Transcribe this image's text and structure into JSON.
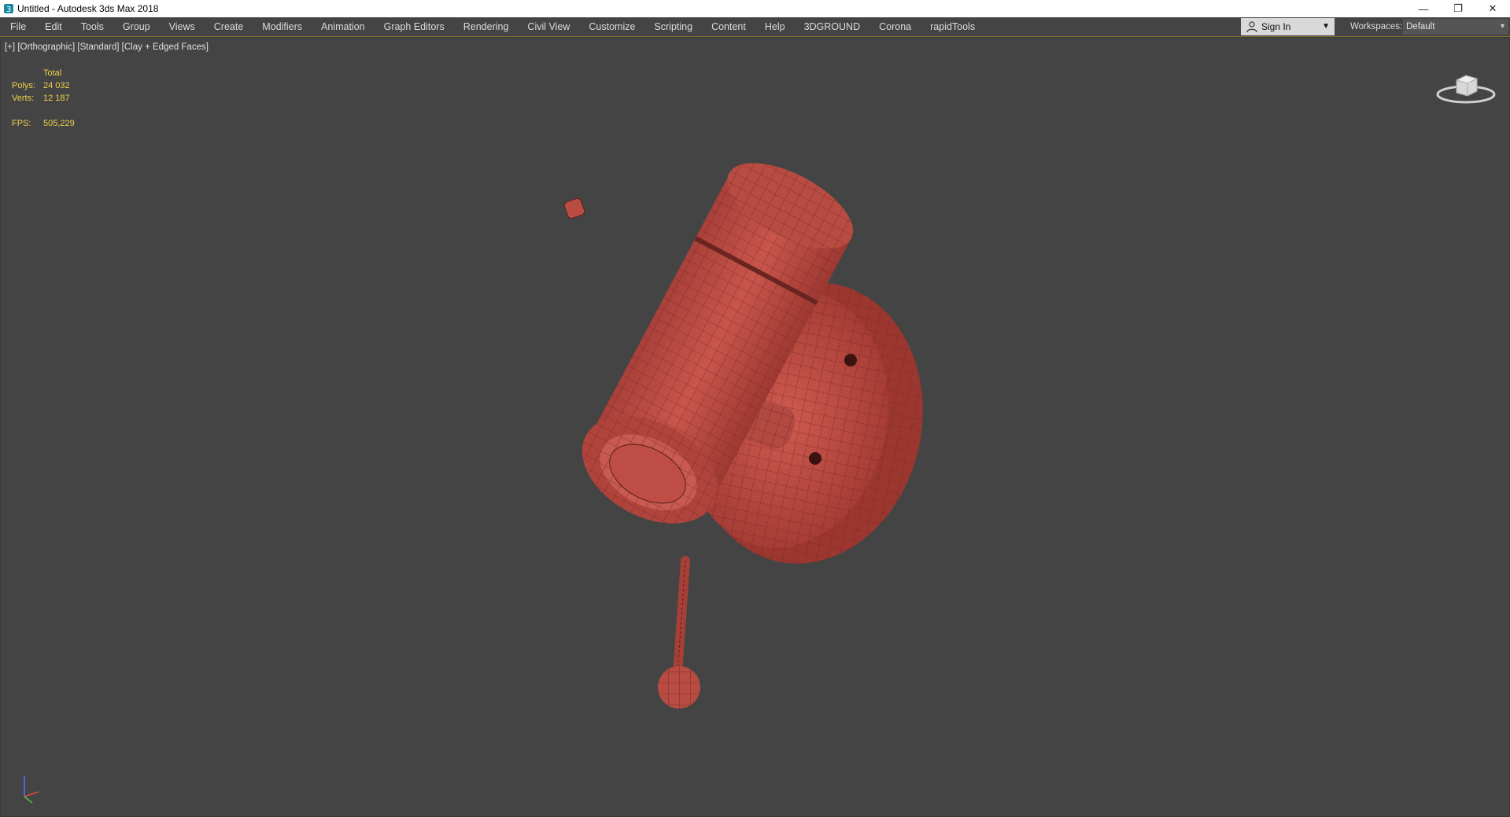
{
  "window": {
    "title": "Untitled - Autodesk 3ds Max 2018",
    "minimize": "—",
    "restore": "❐",
    "close": "✕"
  },
  "menu": [
    "File",
    "Edit",
    "Tools",
    "Group",
    "Views",
    "Create",
    "Modifiers",
    "Animation",
    "Graph Editors",
    "Rendering",
    "Civil View",
    "Customize",
    "Scripting",
    "Content",
    "Help",
    "3DGROUND",
    "Corona",
    "rapidTools"
  ],
  "account": {
    "sign_in": "Sign In"
  },
  "workspaces": {
    "label": "Workspaces:",
    "value": "Default"
  },
  "viewport": {
    "labels": [
      "[+]",
      "[Orthographic]",
      "[Standard]",
      "[Clay + Edged Faces]"
    ],
    "stats": {
      "header": "Total",
      "polys_label": "Polys:",
      "polys_value": "24 032",
      "verts_label": "Verts:",
      "verts_value": "12 187",
      "fps_label": "FPS:",
      "fps_value": "505,229"
    }
  },
  "colors": {
    "background": "#444444",
    "model_red": "#b5453d",
    "stats_yellow": "#f0d24a"
  },
  "icons": [
    "app-icon",
    "user-icon",
    "dropdown-arrow-icon",
    "viewcube-icon",
    "axis-gizmo-icon"
  ]
}
